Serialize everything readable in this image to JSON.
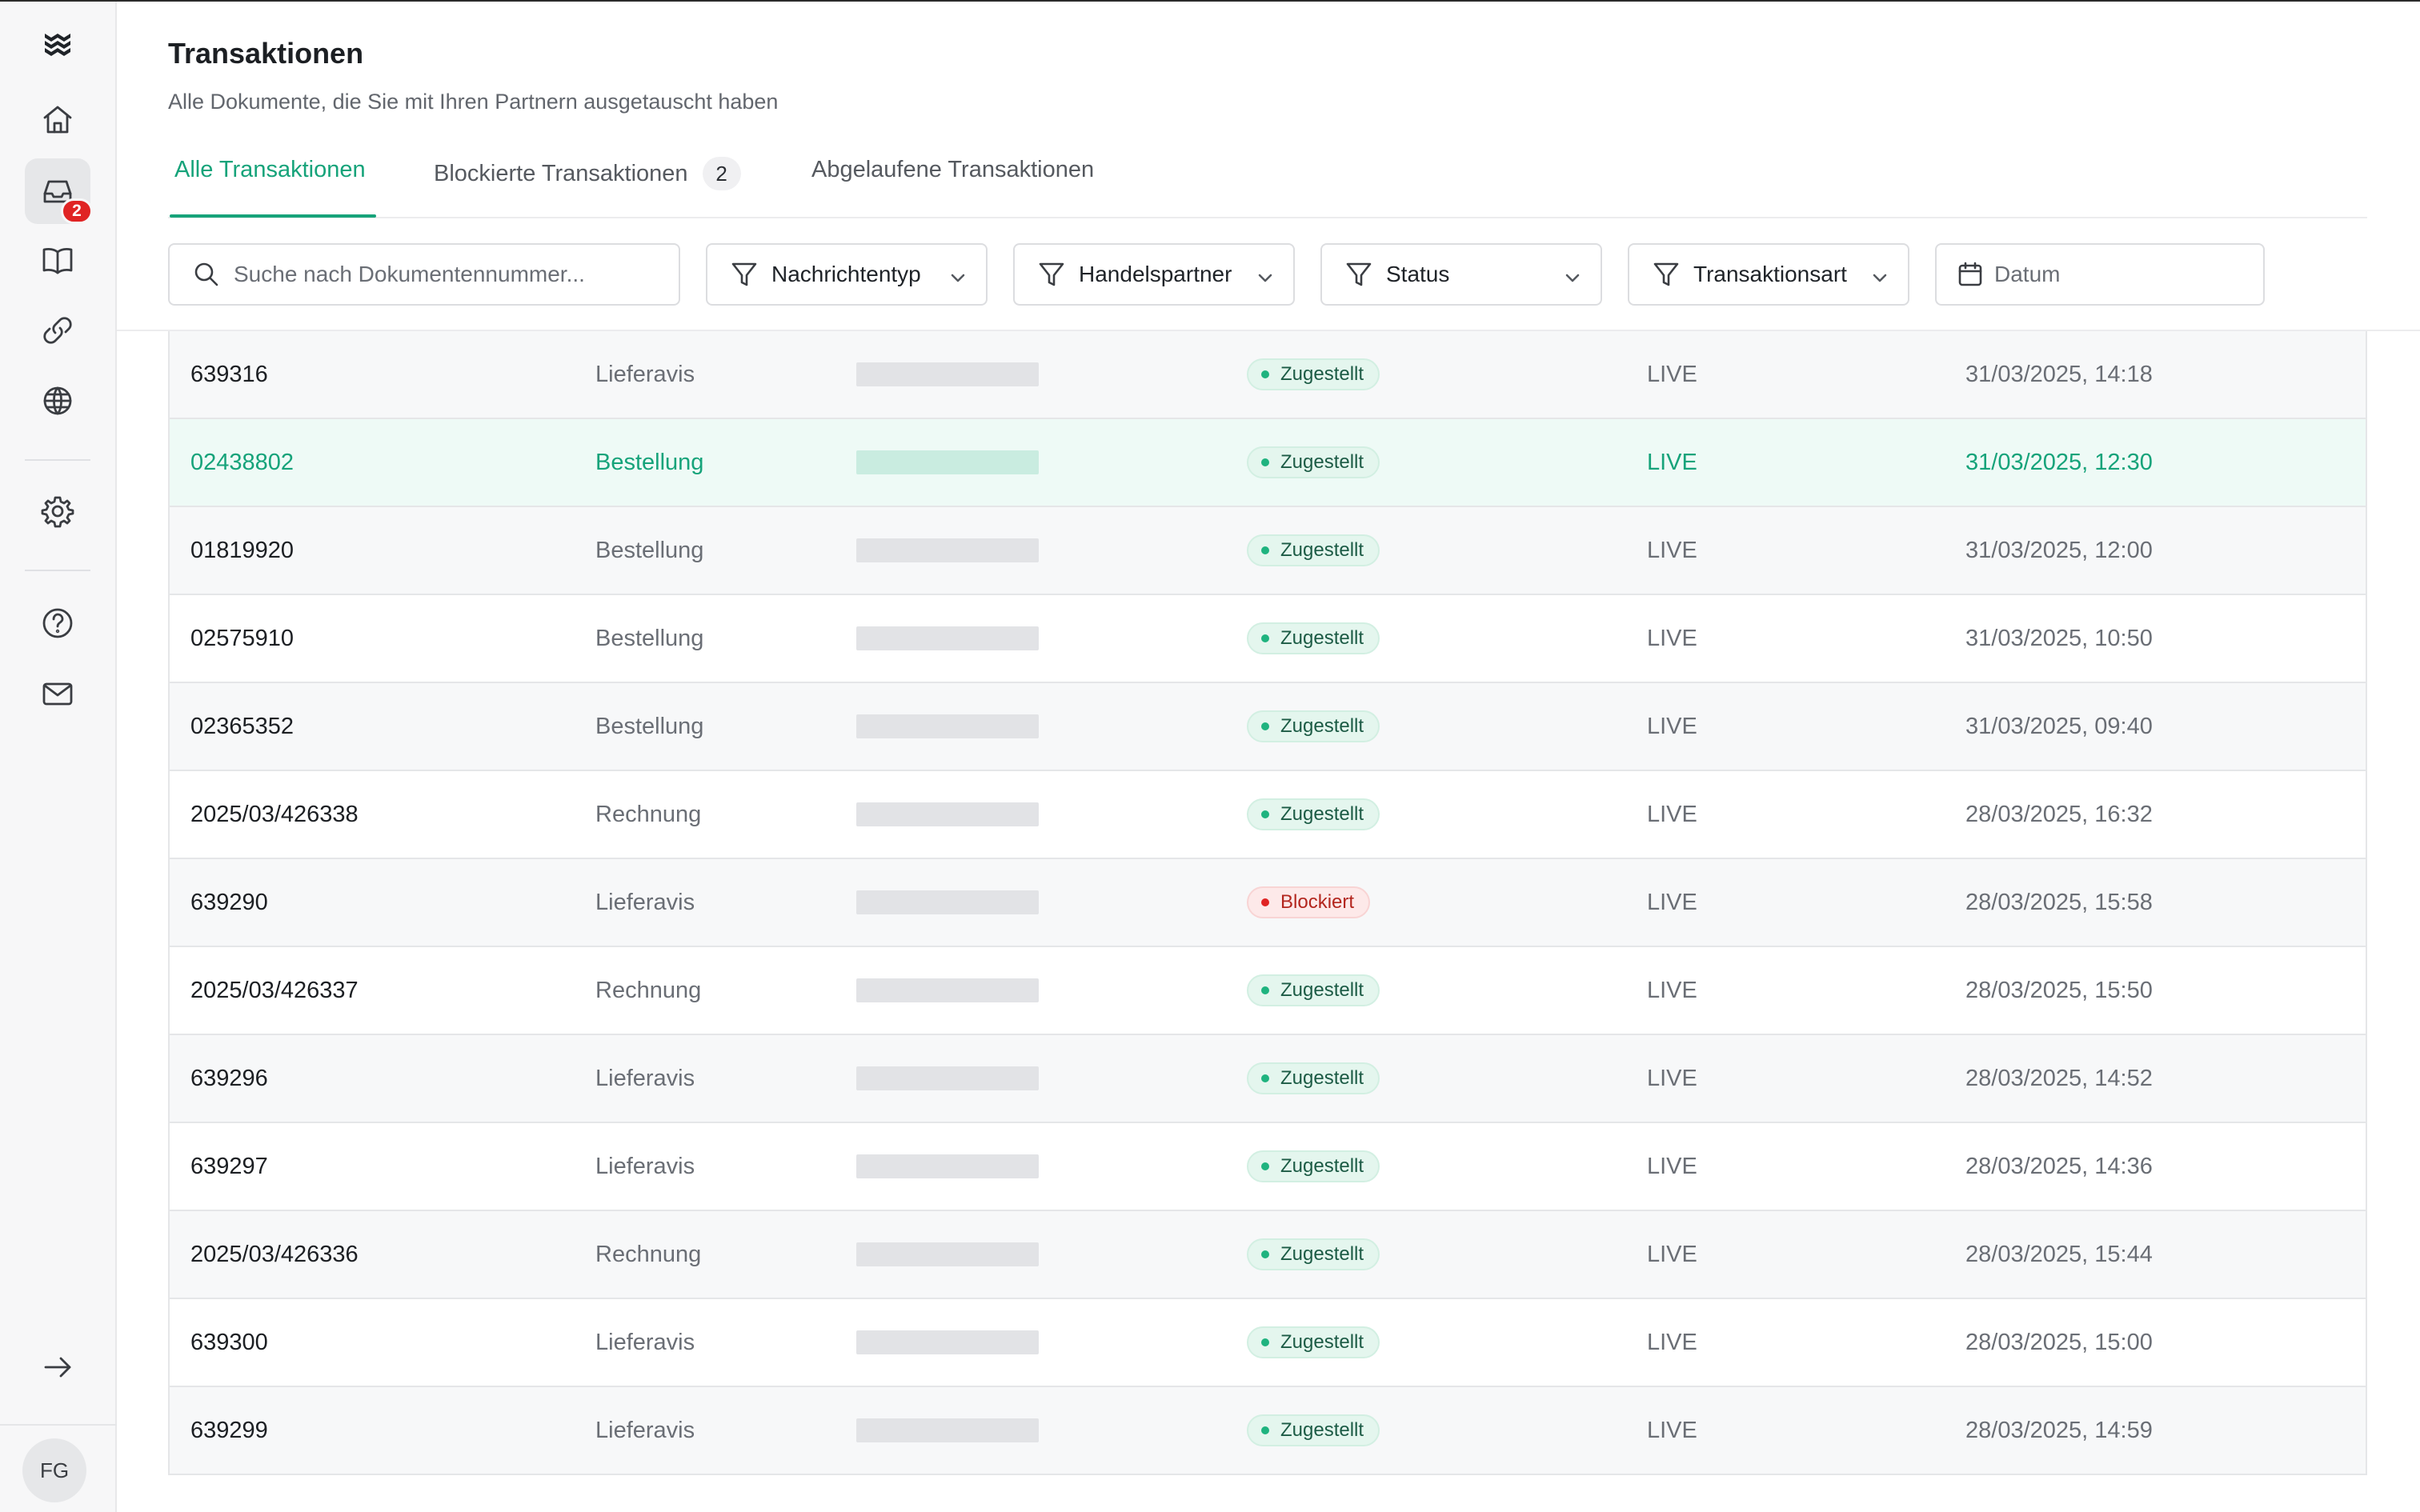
{
  "app": {
    "avatar_initials": "FG",
    "inbox_badge": "2"
  },
  "sidebar": {
    "items": [
      {
        "icon": "home-icon"
      },
      {
        "icon": "inbox-icon",
        "active": true
      },
      {
        "icon": "book-icon"
      },
      {
        "icon": "link-icon"
      },
      {
        "icon": "globe-icon"
      },
      {
        "icon": "gear-icon"
      },
      {
        "icon": "help-icon"
      },
      {
        "icon": "mail-icon"
      },
      {
        "icon": "arrow-right-icon"
      }
    ]
  },
  "header": {
    "title": "Transaktionen",
    "subtitle": "Alle Dokumente, die Sie mit Ihren Partnern ausgetauscht haben"
  },
  "tabs": [
    {
      "label": "Alle Transaktionen",
      "active": true
    },
    {
      "label": "Blockierte Transaktionen",
      "count": "2"
    },
    {
      "label": "Abgelaufene Transaktionen"
    }
  ],
  "filters": {
    "search_placeholder": "Suche nach Dokumentennummer...",
    "message_type": "Nachrichtentyp",
    "trading_partner": "Handelspartner",
    "status": "Status",
    "transaction_type": "Transaktionsart",
    "date_placeholder": "Datum"
  },
  "table": {
    "rows": [
      {
        "id": "639316",
        "type": "Lieferavis",
        "status": "Zugestellt",
        "env": "LIVE",
        "date": "31/03/2025, 14:18"
      },
      {
        "id": "02438802",
        "type": "Bestellung",
        "status": "Zugestellt",
        "env": "LIVE",
        "date": "31/03/2025, 12:30"
      },
      {
        "id": "01819920",
        "type": "Bestellung",
        "status": "Zugestellt",
        "env": "LIVE",
        "date": "31/03/2025, 12:00"
      },
      {
        "id": "02575910",
        "type": "Bestellung",
        "status": "Zugestellt",
        "env": "LIVE",
        "date": "31/03/2025, 10:50"
      },
      {
        "id": "02365352",
        "type": "Bestellung",
        "status": "Zugestellt",
        "env": "LIVE",
        "date": "31/03/2025, 09:40"
      },
      {
        "id": "2025/03/426338",
        "type": "Rechnung",
        "status": "Zugestellt",
        "env": "LIVE",
        "date": "28/03/2025, 16:32"
      },
      {
        "id": "639290",
        "type": "Lieferavis",
        "status": "Blockiert",
        "env": "LIVE",
        "date": "28/03/2025, 15:58"
      },
      {
        "id": "2025/03/426337",
        "type": "Rechnung",
        "status": "Zugestellt",
        "env": "LIVE",
        "date": "28/03/2025, 15:50"
      },
      {
        "id": "639296",
        "type": "Lieferavis",
        "status": "Zugestellt",
        "env": "LIVE",
        "date": "28/03/2025, 14:52"
      },
      {
        "id": "639297",
        "type": "Lieferavis",
        "status": "Zugestellt",
        "env": "LIVE",
        "date": "28/03/2025, 14:36"
      },
      {
        "id": "2025/03/426336",
        "type": "Rechnung",
        "status": "Zugestellt",
        "env": "LIVE",
        "date": "28/03/2025, 15:44"
      },
      {
        "id": "639300",
        "type": "Lieferavis",
        "status": "Zugestellt",
        "env": "LIVE",
        "date": "28/03/2025, 15:00"
      },
      {
        "id": "639299",
        "type": "Lieferavis",
        "status": "Zugestellt",
        "env": "LIVE",
        "date": "28/03/2025, 14:59"
      }
    ]
  },
  "colors": {
    "accent": "#16a37a",
    "error": "#e02424"
  }
}
